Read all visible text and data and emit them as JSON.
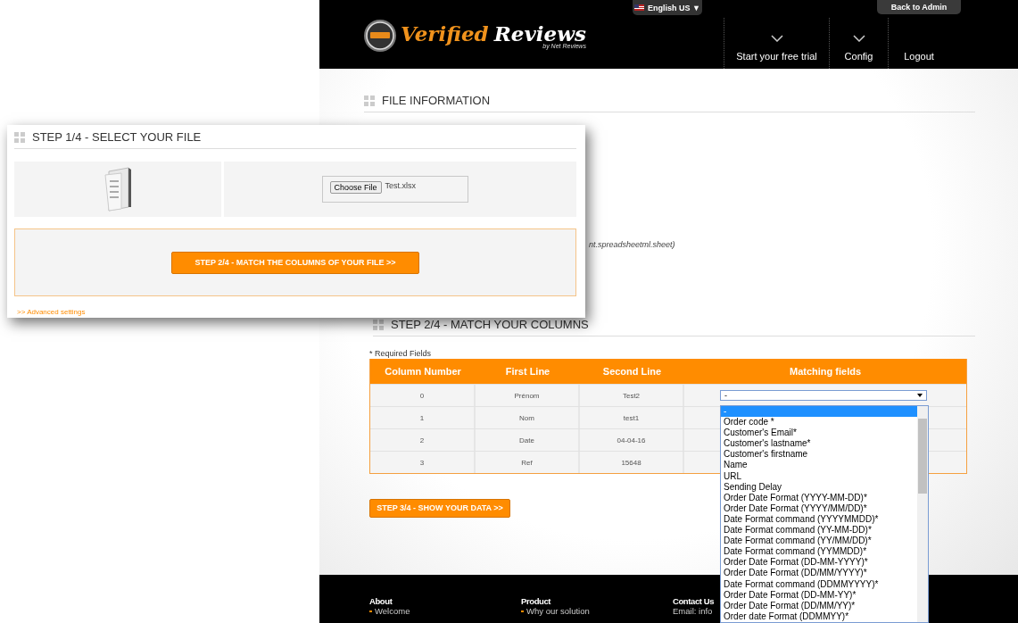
{
  "header": {
    "language": "English US ▼",
    "back_button": "Back to Admin",
    "logo": {
      "word_1": "Verified",
      "word_2": "Reviews",
      "subtitle": "by Net Reviews"
    },
    "nav": [
      {
        "label": "Start your free trial",
        "kind": "dropdown"
      },
      {
        "label": "Config",
        "kind": "dropdown"
      },
      {
        "label": "Logout",
        "kind": "link"
      }
    ]
  },
  "file_information": {
    "title": "FILE INFORMATION",
    "note": "nt.spreadsheetml.sheet)"
  },
  "match_columns": {
    "title": "STEP 2/4 - MATCH YOUR COLUMNS",
    "required_note": "* Required Fields",
    "columns": [
      "Column Number",
      "First Line",
      "Second Line",
      "Matching fields"
    ],
    "rows": [
      {
        "cells": [
          "0",
          "Prénom",
          "Test2"
        ],
        "matching_value": "-"
      },
      {
        "cells": [
          "1",
          "Nom",
          "test1"
        ]
      },
      {
        "cells": [
          "2",
          "Date",
          "04-04-16"
        ]
      },
      {
        "cells": [
          "3",
          "Ref",
          "15648"
        ]
      }
    ],
    "dropdown_options": [
      {
        "label": "-",
        "selected": true
      },
      {
        "label": "Order code *",
        "selected": false
      },
      {
        "label": "Customer's Email*",
        "selected": false
      },
      {
        "label": "Customer's lastname*",
        "selected": false
      },
      {
        "label": "Customer's firstname",
        "selected": false
      },
      {
        "label": "Name",
        "selected": false
      },
      {
        "label": "URL",
        "selected": false
      },
      {
        "label": "Sending Delay",
        "selected": false
      },
      {
        "label": "Order Date Format (YYYY-MM-DD)*",
        "selected": false
      },
      {
        "label": "Order Date Format (YYYY/MM/DD)*",
        "selected": false
      },
      {
        "label": "Date Format command (YYYYMMDD)*",
        "selected": false
      },
      {
        "label": "Date Format command (YY-MM-DD)*",
        "selected": false
      },
      {
        "label": "Date Format command (YY/MM/DD)*",
        "selected": false
      },
      {
        "label": "Date Format command (YYMMDD)*",
        "selected": false
      },
      {
        "label": "Order Date Format (DD-MM-YYYY)*",
        "selected": false
      },
      {
        "label": "Order Date Format (DD/MM/YYYY)*",
        "selected": false
      },
      {
        "label": "Date Format command (DDMMYYYY)*",
        "selected": false
      },
      {
        "label": "Order Date Format (DD-MM-YY)*",
        "selected": false
      },
      {
        "label": "Order Date Format (DD/MM/YY)*",
        "selected": false
      },
      {
        "label": "Order date Format (DDMMYY)*",
        "selected": false
      }
    ],
    "next_button": "STEP 3/4 - SHOW YOUR DATA >>"
  },
  "footer": [
    {
      "heading": "About",
      "link": "Welcome"
    },
    {
      "heading": "Product",
      "link": "Why our solution"
    },
    {
      "heading": "Contact Us",
      "line": "Email: info"
    }
  ],
  "select_file_panel": {
    "title": "STEP 1/4 - SELECT YOUR FILE",
    "choose_button": "Choose File",
    "file_name": "Test.xlsx",
    "next_button": "STEP 2/4 - MATCH THE COLUMNS OF YOUR FILE >>",
    "advanced_link": ">> Advanced settings"
  }
}
